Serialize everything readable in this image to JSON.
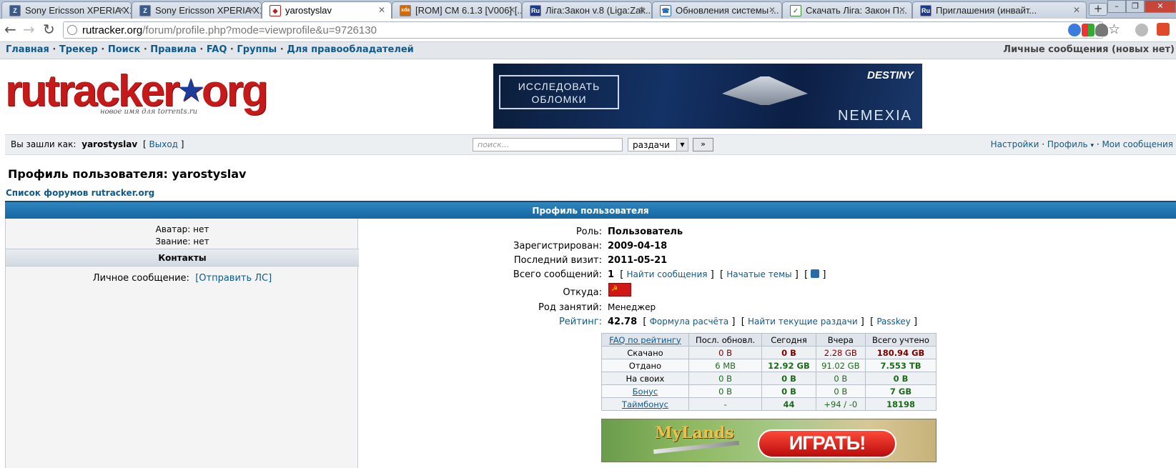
{
  "tabs": [
    {
      "label": "Sony Ericsson XPERIA X1...",
      "favicon": "xda-icon",
      "color": "#3a5a8a"
    },
    {
      "label": "Sony Ericsson XPERIA X1...",
      "favicon": "xda-icon",
      "color": "#3a5a8a"
    },
    {
      "label": "yarostyslav",
      "favicon": "rutracker-icon",
      "color": "#c61a1a"
    },
    {
      "label": "[ROM] CM 6.1.3 [V006] [...",
      "favicon": "xda-dev-icon",
      "color": "#d46a00"
    },
    {
      "label": "Ліга:Закон v.8 (Liga:Zak...",
      "favicon": "ru-icon",
      "color": "#1d3a8a"
    },
    {
      "label": "Обновления системы ...",
      "favicon": "phone-icon",
      "color": "#2a6ab0"
    },
    {
      "label": "Скачать Ліга: Закон П...",
      "favicon": "download-icon",
      "color": "#3a8a3a"
    },
    {
      "label": "Приглашения (инвайт...",
      "favicon": "ru-icon",
      "color": "#1d3a8a"
    }
  ],
  "favicon_text": {
    "ru": "Ru",
    "xda": "xda"
  },
  "address": {
    "host": "rutracker.org",
    "path": "/forum/profile.php?mode=viewprofile&u=9726130"
  },
  "menu": {
    "links": [
      "Главная",
      "Трекер",
      "Поиск",
      "Правила",
      "FAQ",
      "Группы",
      "Для правообладателей"
    ],
    "separator": " · ",
    "pm": "Личные сообщения (новых нет)"
  },
  "logo": {
    "text": "rutracker",
    "star": "★",
    "tld": "org",
    "sub": "новое имя для torrents.ru"
  },
  "banner": {
    "cta": "ИССЛЕДОВАТЬ ОБЛОМКИ",
    "brand": "DESTINY",
    "game": "NEMEXIA"
  },
  "userbar": {
    "logged_as": "Вы зашли как:",
    "username": "yarostyslav",
    "logout": "Выход",
    "search_placeholder": "поиск...",
    "search_scope": "раздачи",
    "go": "»",
    "settings": "Настройки",
    "profile": "Профиль",
    "messages": "Мои сообщения"
  },
  "page": {
    "title": "Профиль пользователя: yarostyslav",
    "forum_list": "Список форумов rutracker.org",
    "panel_header": "Профиль пользователя"
  },
  "left": {
    "avatar": "Аватар: нет",
    "rank": "Звание: нет",
    "contacts": "Контакты",
    "pm_label": "Личное сообщение:",
    "pm_link": "[Отправить ЛС]"
  },
  "profile": {
    "role_l": "Роль:",
    "role": "Пользователь",
    "reg_l": "Зарегистрирован:",
    "reg": "2009-04-18",
    "visit_l": "Последний визит:",
    "visit": "2011-05-21",
    "posts_l": "Всего сообщений:",
    "posts": "1",
    "find_posts": "Найти сообщения",
    "started": "Начатые темы",
    "from_l": "Откуда:",
    "occ_l": "Род занятий:",
    "occ": "Менеджер",
    "rating_l": "Рейтинг:",
    "rating": "42.78",
    "formula": "Формула расчёта",
    "current": "Найти текущие раздачи",
    "passkey": "Passkey"
  },
  "ratio_table": {
    "headers": [
      "FAQ по рейтингу",
      "Посл. обновл.",
      "Сегодня",
      "Вчера",
      "Всего учтено"
    ],
    "rows": [
      {
        "name": "Скачано",
        "last": "0 B",
        "today": "0 B",
        "yesterday": "2.28 GB",
        "total": "180.94 GB"
      },
      {
        "name": "Отдано",
        "last": "6 MB",
        "today": "12.92 GB",
        "yesterday": "91.02 GB",
        "total": "7.553 TB"
      },
      {
        "name": "На своих",
        "last": "0 B",
        "today": "0 B",
        "yesterday": "0 B",
        "total": "0 B"
      },
      {
        "name": "Бонус",
        "last": "0 B",
        "today": "0 B",
        "yesterday": "0 B",
        "total": "7 GB"
      },
      {
        "name": "Таймбонус",
        "last": "-",
        "today": "44",
        "yesterday": "+94 / -0",
        "total": "18198"
      }
    ]
  },
  "ad": {
    "brand": "MyLands",
    "cta": "ИГРАТЬ!"
  }
}
